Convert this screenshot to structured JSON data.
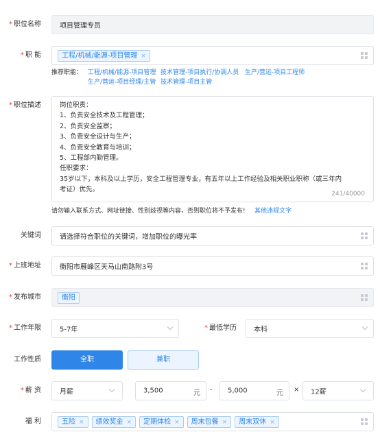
{
  "fields": {
    "title": {
      "label": "职位名称",
      "placeholder": "项目管理专员"
    },
    "function": {
      "label": "职 能",
      "tag": "工程/机械/能源-项目管理",
      "rec_label": "推荐职能：",
      "rec": [
        "工程/机械/能源-项目管理",
        "技术管理-项目执行/协调人员",
        "生产/营运-项目工程师",
        "生产/营运-项目经理/主管",
        "技术管理-项目主管"
      ]
    },
    "desc": {
      "label": "职位描述",
      "lines": [
        "岗位职责：",
        "1、负责安全技术及工程管理；",
        "2、负责安全监察；",
        "3、负责安全设计与生产；",
        "4、负责安全教育与培训；",
        "5、工程部内勤管理。",
        "任职要求：",
        "35岁以下，本科及以上学历，安全工程管理专业，有五年以上工作经验及相关职业职称（或三年内",
        "考证）优先。"
      ],
      "count": "241/40000",
      "note": "请勿输入联系方式、网址链接、性别歧视等内容，否则职位将不予发布!",
      "note_link": "其他违规文字"
    },
    "keywords": {
      "label": "关键词",
      "placeholder": "请选择符合职位的关键词，增加职位的曝光率"
    },
    "address": {
      "label": "上班地址",
      "value": "衡阳市雁峰区天马山南路附3号"
    },
    "city": {
      "label": "发布城市",
      "tag": "衡阳"
    },
    "experience": {
      "label": "工作年限",
      "value": "5-7年"
    },
    "education": {
      "label": "最低学历",
      "value": "本科"
    },
    "nature": {
      "label": "工作性质",
      "options": [
        "全职",
        "兼职"
      ],
      "selected": "全职"
    },
    "salary": {
      "label": "薪 资",
      "type": "月薪",
      "min": "3,500",
      "max": "5,000",
      "unit": "元",
      "dash": "-",
      "times": "×",
      "months": "12薪"
    },
    "benefits": {
      "label": "福 利",
      "tags": [
        "五险",
        "绩效奖金",
        "定期体检",
        "周末包餐",
        "周末双休"
      ]
    }
  },
  "colors": {
    "accent": "#2f86e8",
    "required": "#e4393c",
    "tag_bg": "#ecf5ff"
  }
}
